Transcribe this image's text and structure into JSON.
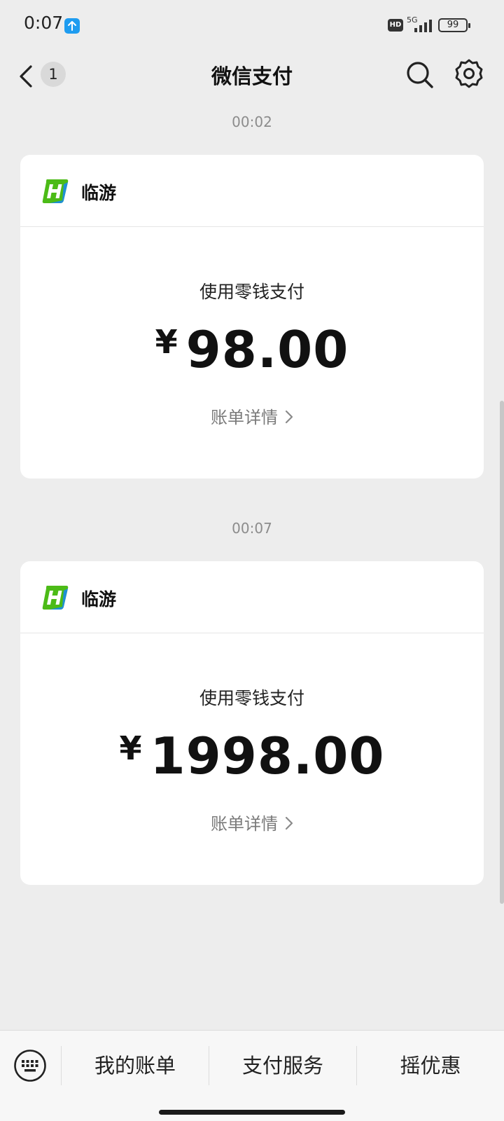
{
  "status_bar": {
    "time": "0:07",
    "hd": "HD",
    "network": "5G",
    "battery": "99"
  },
  "header": {
    "title": "微信支付",
    "unread_count": "1"
  },
  "messages": [
    {
      "time": "00:02",
      "merchant": "临游",
      "method": "使用零钱支付",
      "currency": "¥",
      "amount": "98.00",
      "detail_label": "账单详情"
    },
    {
      "time": "00:07",
      "merchant": "临游",
      "method": "使用零钱支付",
      "currency": "¥",
      "amount": "1998.00",
      "detail_label": "账单详情"
    }
  ],
  "bottom_menu": {
    "items": [
      "我的账单",
      "支付服务",
      "摇优惠"
    ]
  },
  "colors": {
    "background": "#ededed",
    "card": "#ffffff",
    "logo_green": "#4cbb17",
    "logo_blue": "#1f8fd6",
    "upload_badge": "#1e9cf0"
  },
  "icons": {
    "back": "chevron-left-icon",
    "search": "search-icon",
    "settings": "gear-icon",
    "keyboard": "keyboard-icon",
    "detail": "chevron-right-icon"
  }
}
